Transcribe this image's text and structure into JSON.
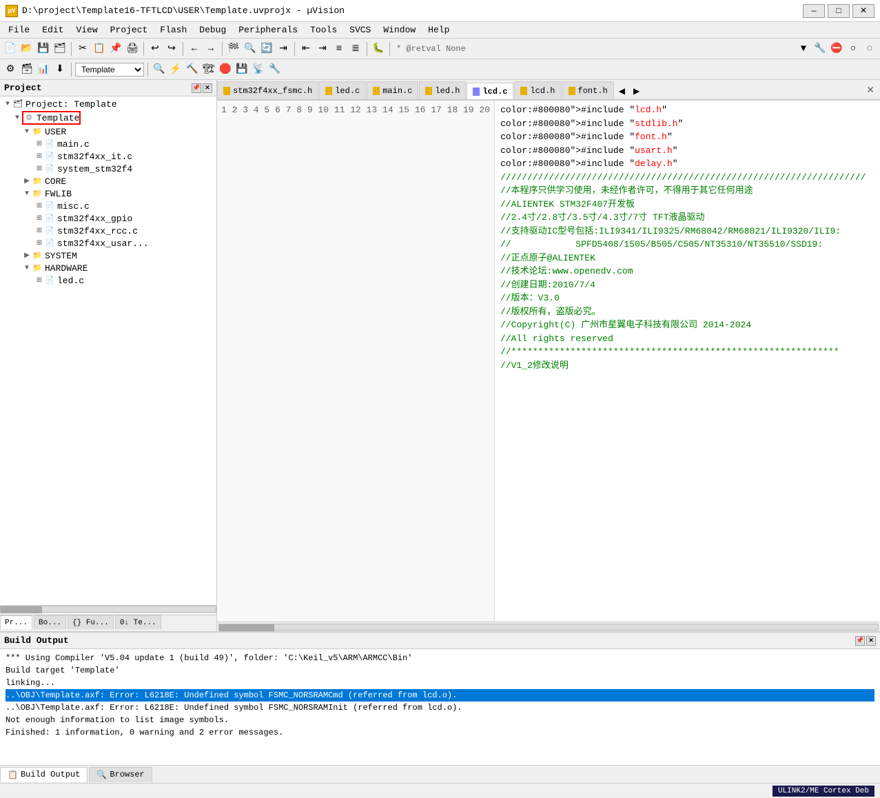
{
  "titlebar": {
    "title": "D:\\project\\Template16-TFTLCD\\USER\\Template.uvprojx - µVision",
    "icon_label": "µV",
    "minimize": "—",
    "maximize": "□",
    "close": "✕"
  },
  "menubar": {
    "items": [
      "File",
      "Edit",
      "View",
      "Project",
      "Flash",
      "Debug",
      "Peripherals",
      "Tools",
      "SVCS",
      "Window",
      "Help"
    ]
  },
  "toolbar1": {
    "retval_label": "* @retval None"
  },
  "toolbar2": {
    "target": "Template"
  },
  "project_panel": {
    "title": "Project",
    "root": "Project: Template",
    "tree": [
      {
        "level": 0,
        "type": "root",
        "label": "Project: Template",
        "expanded": true
      },
      {
        "level": 1,
        "type": "folder-gear",
        "label": "Template",
        "expanded": true,
        "highlighted": true
      },
      {
        "level": 2,
        "type": "folder",
        "label": "USER",
        "expanded": true
      },
      {
        "level": 3,
        "type": "file",
        "label": "main.c"
      },
      {
        "level": 3,
        "type": "file",
        "label": "stm32f4xx_it.c"
      },
      {
        "level": 3,
        "type": "file",
        "label": "system_stm32f4"
      },
      {
        "level": 2,
        "type": "folder",
        "label": "CORE",
        "expanded": false
      },
      {
        "level": 2,
        "type": "folder",
        "label": "FWLIB",
        "expanded": true
      },
      {
        "level": 3,
        "type": "file",
        "label": "misc.c"
      },
      {
        "level": 3,
        "type": "file",
        "label": "stm32f4xx_gpio"
      },
      {
        "level": 3,
        "type": "file",
        "label": "stm32f4xx_rcc.c"
      },
      {
        "level": 3,
        "type": "file",
        "label": "stm32f4xx_usar..."
      },
      {
        "level": 2,
        "type": "folder",
        "label": "SYSTEM",
        "expanded": false
      },
      {
        "level": 2,
        "type": "folder",
        "label": "HARDWARE",
        "expanded": true
      },
      {
        "level": 3,
        "type": "file",
        "label": "led.c"
      }
    ]
  },
  "tabs": [
    {
      "label": "stm32f4xx_fsmc.h",
      "icon_color": "#e8b000",
      "active": false
    },
    {
      "label": "led.c",
      "icon_color": "#e8b000",
      "active": false
    },
    {
      "label": "main.c",
      "icon_color": "#e8b000",
      "active": false
    },
    {
      "label": "led.h",
      "icon_color": "#e8b000",
      "active": false
    },
    {
      "label": "lcd.c",
      "icon_color": "#8080ff",
      "active": true
    },
    {
      "label": "lcd.h",
      "icon_color": "#e8b000",
      "active": false
    },
    {
      "label": "font.h",
      "icon_color": "#e8b000",
      "active": false
    }
  ],
  "code": {
    "lines": [
      {
        "num": 1,
        "text": "#include \"lcd.h\"",
        "type": "include"
      },
      {
        "num": 2,
        "text": "#include \"stdlib.h\"",
        "type": "include"
      },
      {
        "num": 3,
        "text": "#include \"font.h\"",
        "type": "include"
      },
      {
        "num": 4,
        "text": "#include \"usart.h\"",
        "type": "include"
      },
      {
        "num": 5,
        "text": "#include \"delay.h\"",
        "type": "include"
      },
      {
        "num": 6,
        "text": "////////////////////////////////////////////////////////////////////",
        "type": "comment"
      },
      {
        "num": 7,
        "text": "//本程序只供学习使用，未经作者许可，不得用于其它任何用途",
        "type": "comment"
      },
      {
        "num": 8,
        "text": "//ALIENTEK STM32F407开发板",
        "type": "comment"
      },
      {
        "num": 9,
        "text": "//2.4寸/2.8寸/3.5寸/4.3寸/7寸 TFT液晶驱动",
        "type": "comment"
      },
      {
        "num": 10,
        "text": "//支持驱动IC型号包括:ILI9341/ILI9325/RM68042/RM68021/ILI9320/ILI9:",
        "type": "comment"
      },
      {
        "num": 11,
        "text": "//            SPFD5408/1505/B505/C505/NT35310/NT35510/SSD19:",
        "type": "comment"
      },
      {
        "num": 12,
        "text": "//正点原子@ALIENTEK",
        "type": "comment"
      },
      {
        "num": 13,
        "text": "//技术论坛:www.openedv.com",
        "type": "comment"
      },
      {
        "num": 14,
        "text": "//创建日期:2010/7/4",
        "type": "comment"
      },
      {
        "num": 15,
        "text": "//版本：V3.0",
        "type": "comment"
      },
      {
        "num": 16,
        "text": "//版权所有，盗版必究。",
        "type": "comment"
      },
      {
        "num": 17,
        "text": "//Copyright(C) 广州市星翼电子科技有限公司 2014-2024",
        "type": "comment"
      },
      {
        "num": 18,
        "text": "//All rights reserved",
        "type": "comment"
      },
      {
        "num": 19,
        "text": "//*************************************************************",
        "type": "comment"
      },
      {
        "num": 20,
        "text": "//V1_2修改说明",
        "type": "comment"
      }
    ]
  },
  "build_output": {
    "title": "Build Output",
    "lines": [
      {
        "text": "*** Using Compiler 'V5.04 update 1 (build 49)', folder: 'C:\\Keil_v5\\ARM\\ARMCC\\Bin'",
        "type": "normal"
      },
      {
        "text": "Build target 'Template'",
        "type": "normal"
      },
      {
        "text": "linking...",
        "type": "normal"
      },
      {
        "text": "..\\OBJ\\Template.axf: Error: L6218E: Undefined symbol FSMC_NORSRAMCmd (referred from lcd.o).",
        "type": "error"
      },
      {
        "text": "..\\OBJ\\Template.axf: Error: L6218E: Undefined symbol FSMC_NORSRAMInit (referred from lcd.o).",
        "type": "normal"
      },
      {
        "text": "Not enough information to list image symbols.",
        "type": "normal"
      },
      {
        "text": "Finished: 1 information, 0 warning and 2 error messages.",
        "type": "normal"
      }
    ]
  },
  "bottom_tabs": [
    {
      "label": "Build Output",
      "icon": "📋",
      "active": true
    },
    {
      "label": "Browser",
      "icon": "🔍",
      "active": false
    }
  ],
  "statusbar": {
    "left": "",
    "right": "ULINK2/ME Cortex Deb"
  },
  "project_bottom_tabs": [
    {
      "label": "Pr...",
      "active": true
    },
    {
      "label": "Bo...",
      "active": false
    },
    {
      "label": "{} Fu...",
      "active": false
    },
    {
      "label": "0↓ Te...",
      "active": false
    }
  ]
}
